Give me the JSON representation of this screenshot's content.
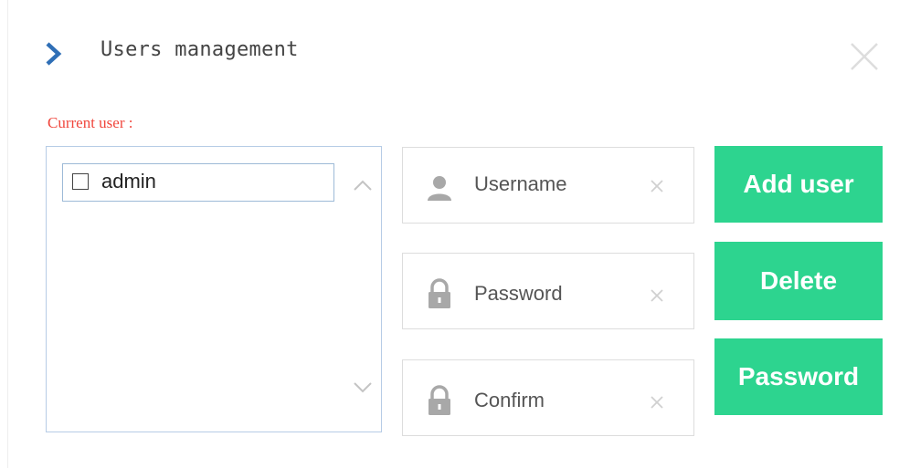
{
  "dialog": {
    "title": "Users management",
    "icons": {
      "header": "chevron-right-icon",
      "close": "close-icon"
    }
  },
  "current_user": {
    "label": "Current user :"
  },
  "user_list": {
    "items": [
      {
        "label": "admin",
        "checked": false
      }
    ]
  },
  "form": {
    "username": {
      "placeholder": "Username",
      "value": "",
      "icon": "user-icon"
    },
    "password": {
      "placeholder": "Password",
      "value": "",
      "icon": "lock-icon"
    },
    "confirm": {
      "placeholder": "Confirm",
      "value": "",
      "icon": "lock-icon"
    }
  },
  "actions": {
    "add_user_label": "Add user",
    "delete_label": "Delete",
    "password_label": "Password"
  },
  "colors": {
    "accent": "#2dd48f",
    "label_red": "#f0463c",
    "chevron_blue": "#2f6fb6",
    "list_border": "#b6cce6"
  }
}
